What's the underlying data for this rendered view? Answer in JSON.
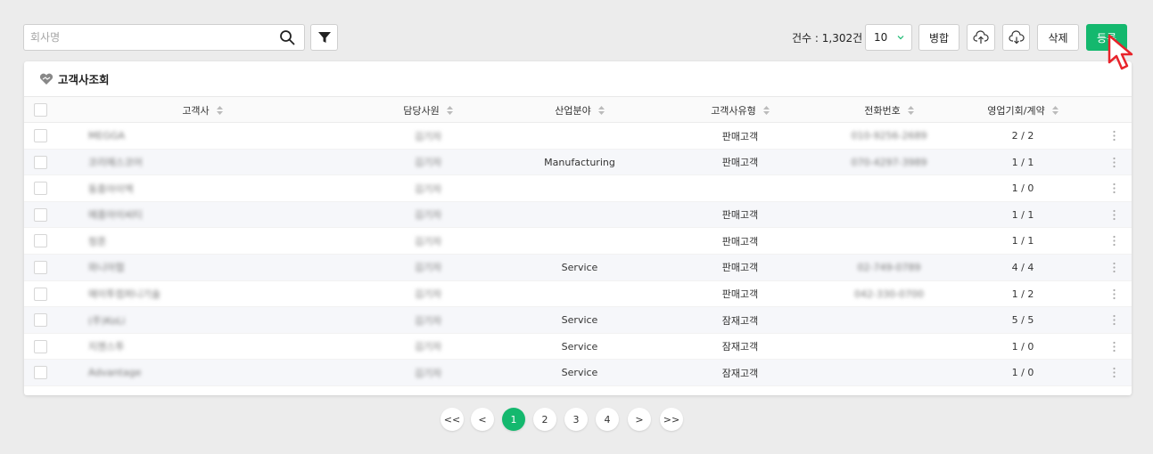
{
  "search": {
    "placeholder": "회사명",
    "value": ""
  },
  "toolbar": {
    "count_label": "건수 : 1,302건",
    "page_size": "10",
    "merge_label": "병합",
    "delete_label": "삭제",
    "register_label": "등록"
  },
  "panel": {
    "title": "고객사조회",
    "columns": [
      "고객사",
      "담당사원",
      "산업분야",
      "고객사유형",
      "전화번호",
      "영업기회/계약"
    ],
    "rows": [
      {
        "company": "MEGGA",
        "owner": "김기자",
        "industry": "",
        "type": "판매고객",
        "phone": "010-9256-2689",
        "deals": "2 / 2"
      },
      {
        "company": "코리에스코어",
        "owner": "김기자",
        "industry": "Manufacturing",
        "type": "판매고객",
        "phone": "070-4297-3989",
        "deals": "1 / 1"
      },
      {
        "company": "동흥아이엑",
        "owner": "김기자",
        "industry": "",
        "type": "",
        "phone": "",
        "deals": "1 / 0"
      },
      {
        "company": "에흥아이씨티",
        "owner": "김기자",
        "industry": "",
        "type": "판매고객",
        "phone": "",
        "deals": "1 / 1"
      },
      {
        "company": "청흔",
        "owner": "김기자",
        "industry": "",
        "type": "판매고객",
        "phone": "",
        "deals": "1 / 1"
      },
      {
        "company": "와니아협",
        "owner": "김기자",
        "industry": "Service",
        "type": "판매고객",
        "phone": "02-749-0789",
        "deals": "4 / 4"
      },
      {
        "company": "에이투컴퍼니기술",
        "owner": "김기자",
        "industry": "",
        "type": "판매고객",
        "phone": "042-330-0700",
        "deals": "1 / 2"
      },
      {
        "company": "(주)KoLi",
        "owner": "김기자",
        "industry": "Service",
        "type": "잠재고객",
        "phone": "",
        "deals": "5 / 5"
      },
      {
        "company": "지젠스투",
        "owner": "김기자",
        "industry": "Service",
        "type": "잠재고객",
        "phone": "",
        "deals": "1 / 0"
      },
      {
        "company": "Advantage",
        "owner": "김기자",
        "industry": "Service",
        "type": "잠재고객",
        "phone": "",
        "deals": "1 / 0"
      }
    ]
  },
  "pagination": {
    "first": "<<",
    "prev": "<",
    "pages": [
      "1",
      "2",
      "3",
      "4"
    ],
    "next": ">",
    "last": ">>",
    "current": "1"
  },
  "colors": {
    "accent": "#14b86e",
    "cursor": "#e8242b"
  }
}
